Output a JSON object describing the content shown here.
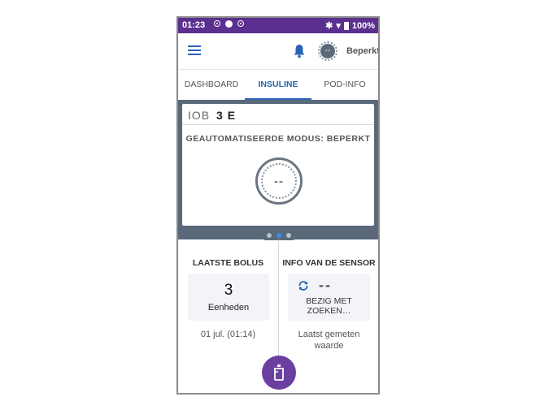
{
  "statusbar": {
    "time": "01:23",
    "battery_pct": "100%"
  },
  "appbar": {
    "mode_label": "Beperkt",
    "mode_icon_text": "--"
  },
  "tabs": [
    {
      "label": "DASHBOARD"
    },
    {
      "label": "INSULINE"
    },
    {
      "label": "POD-INFO"
    }
  ],
  "active_tab": "INSULINE",
  "insulin_card": {
    "iob_label": "IOB",
    "iob_value": "3 E",
    "mode_heading": "GEAUTOMATISEERDE MODUS: BEPERKT",
    "circle_text": "--"
  },
  "pager": {
    "pages": 3,
    "active_index": 1
  },
  "last_bolus": {
    "title": "LAATSTE BOLUS",
    "value": "3",
    "unit": "Eenheden",
    "timestamp": "01 jul. (01:14)"
  },
  "sensor": {
    "title": "INFO VAN DE SENSOR",
    "value": "--",
    "status": "BEZIG MET ZOEKEN…",
    "caption": "Laatst gemeten waarde"
  },
  "colors": {
    "status_bar": "#5b2f8f",
    "accent_blue": "#2a62b5",
    "slate": "#59697a",
    "fab": "#6b3fa0"
  },
  "icons": {
    "menu": "hamburger-icon",
    "notifications": "bell-icon",
    "automated_mode": "automated-mode-icon",
    "sensor": "refresh-icon",
    "fab": "pod-bolus-icon"
  }
}
